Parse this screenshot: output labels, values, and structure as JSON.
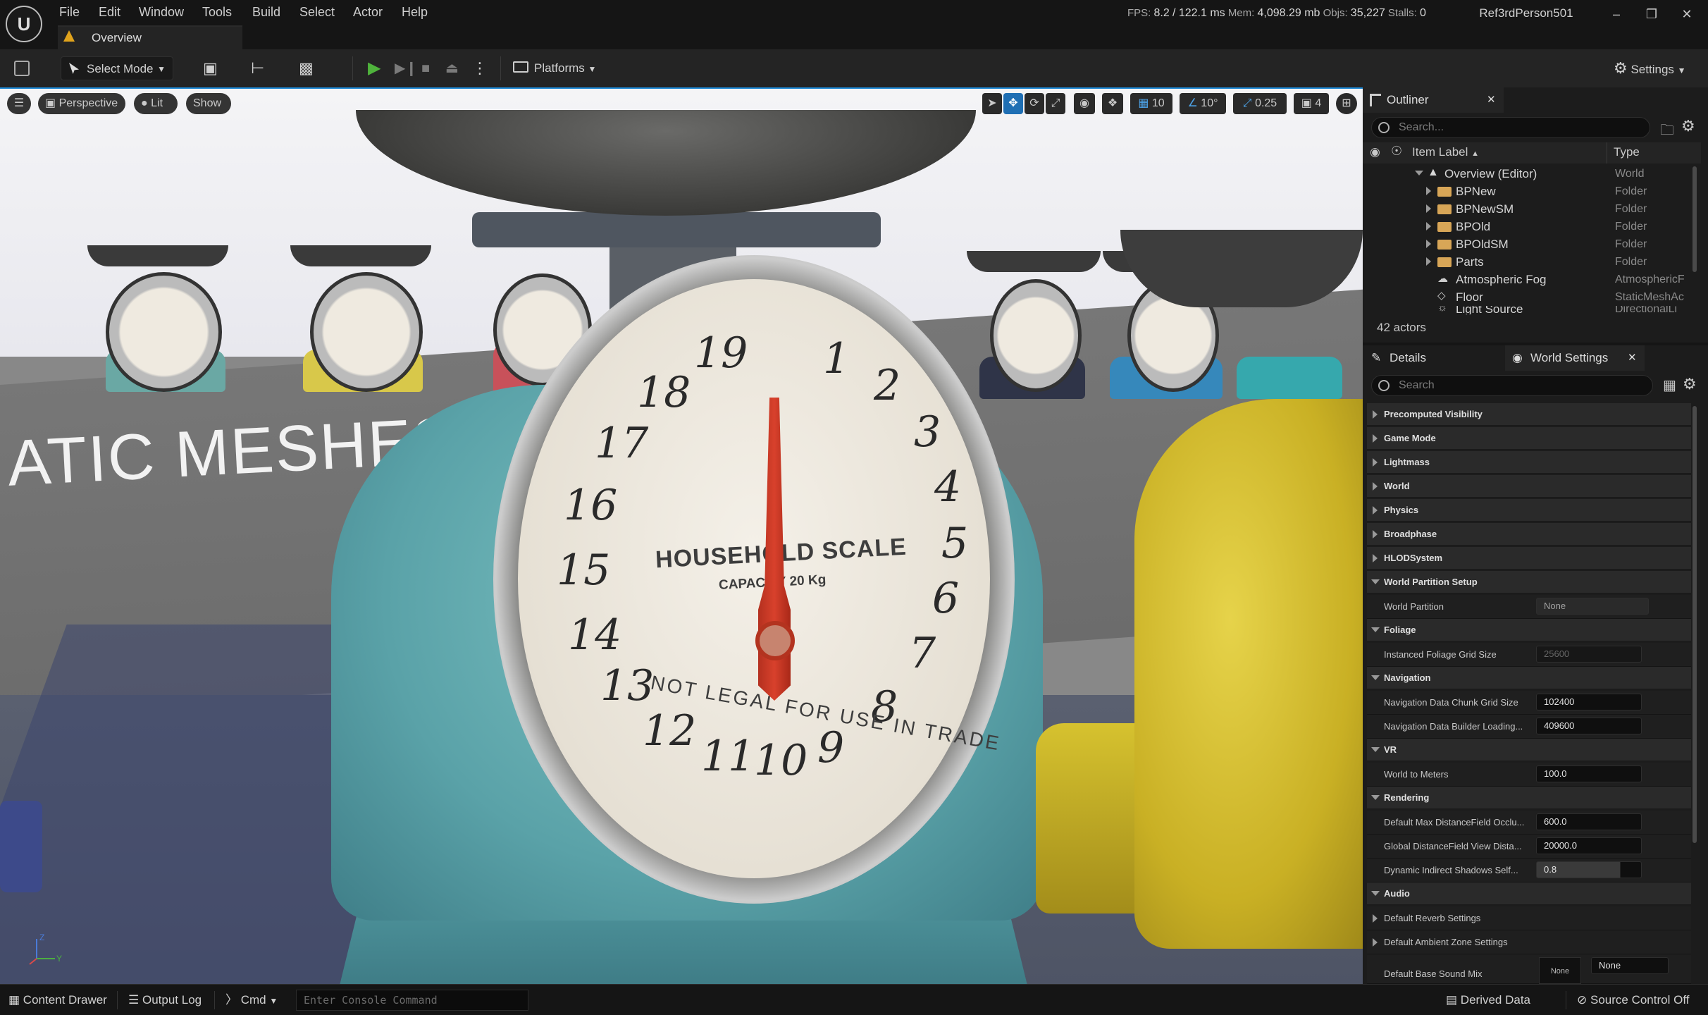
{
  "app": {
    "logo": "U",
    "menu": [
      "File",
      "Edit",
      "Window",
      "Tools",
      "Build",
      "Select",
      "Actor",
      "Help"
    ],
    "document_tab": "Overview",
    "stats": {
      "fps_label": "FPS:",
      "fps": "8.2",
      "ms": "/ 122.1 ms",
      "mem_label": "Mem:",
      "mem": "4,098.29 mb",
      "objs_label": "Objs:",
      "objs": "35,227",
      "stalls_label": "Stalls:",
      "stalls": "0"
    },
    "project_name": "Ref3rdPerson501",
    "window_controls": [
      "–",
      "❐",
      "✕"
    ]
  },
  "toolbar": {
    "select_mode": "Select Mode",
    "platforms": "Platforms",
    "settings": "Settings"
  },
  "viewport": {
    "view_mode": "Perspective",
    "lighting": "Lit",
    "show": "Show",
    "grid_snap": "10",
    "rotation_snap": "10°",
    "scale_snap": "0.25",
    "camera_speed": "4",
    "wall_text": "ATIC MESHES",
    "dial": {
      "brand": "HOUSEHOLD SCALE",
      "capacity": "CAPACITY 20 Kg",
      "legal": "NOT LEGAL FOR USE IN TRADE",
      "numbers": [
        "19",
        "1",
        "2",
        "3",
        "4",
        "5",
        "6",
        "7",
        "8",
        "9",
        "10",
        "11",
        "12",
        "13",
        "14",
        "15",
        "16",
        "17",
        "18"
      ]
    }
  },
  "outliner": {
    "tab": "Outliner",
    "search_placeholder": "Search...",
    "col_label": "Item Label",
    "col_type": "Type",
    "rows": [
      {
        "label": "Overview (Editor)",
        "type": "World"
      },
      {
        "label": "BPNew",
        "type": "Folder"
      },
      {
        "label": "BPNewSM",
        "type": "Folder"
      },
      {
        "label": "BPOld",
        "type": "Folder"
      },
      {
        "label": "BPOldSM",
        "type": "Folder"
      },
      {
        "label": "Parts",
        "type": "Folder"
      },
      {
        "label": "Atmospheric Fog",
        "type": "AtmosphericF"
      },
      {
        "label": "Floor",
        "type": "StaticMeshAc"
      },
      {
        "label": "Light Source",
        "type": "DirectionalLi"
      }
    ],
    "actor_count": "42 actors"
  },
  "details": {
    "tab_details": "Details",
    "tab_world_settings": "World Settings",
    "search_placeholder": "Search",
    "sections": {
      "precomputed_visibility": "Precomputed Visibility",
      "game_mode": "Game Mode",
      "lightmass": "Lightmass",
      "world": "World",
      "physics": "Physics",
      "broadphase": "Broadphase",
      "hlod": "HLODSystem",
      "world_partition_setup": "World Partition Setup",
      "foliage": "Foliage",
      "navigation": "Navigation",
      "vr": "VR",
      "rendering": "Rendering",
      "audio": "Audio"
    },
    "props": {
      "world_partition": {
        "label": "World Partition",
        "value": "None"
      },
      "foliage_grid": {
        "label": "Instanced Foliage Grid Size",
        "value": "25600"
      },
      "nav_chunk": {
        "label": "Navigation Data Chunk Grid Size",
        "value": "102400"
      },
      "nav_builder": {
        "label": "Navigation Data Builder Loading...",
        "value": "409600"
      },
      "world_to_meters": {
        "label": "World to Meters",
        "value": "100.0"
      },
      "df_occlusion": {
        "label": "Default Max DistanceField Occlu...",
        "value": "600.0"
      },
      "df_view_dist": {
        "label": "Global DistanceField View Dista...",
        "value": "20000.0"
      },
      "dyn_shadows": {
        "label": "Dynamic Indirect Shadows Self...",
        "value": "0.8"
      },
      "reverb": {
        "label": "Default Reverb Settings"
      },
      "ambient_zone": {
        "label": "Default Ambient Zone Settings"
      },
      "sound_mix": {
        "label": "Default Base Sound Mix",
        "value": "None",
        "thumb": "None"
      }
    }
  },
  "statusbar": {
    "content_drawer": "Content Drawer",
    "output_log": "Output Log",
    "cmd": "Cmd",
    "console_placeholder": "Enter Console Command",
    "derived_data": "Derived Data",
    "source_control": "Source Control Off"
  },
  "colors": {
    "accent_blue": "#1f6fb4",
    "play_green": "#4fb33c",
    "folder": "#d8a657",
    "tab_warning": "#e0a31c"
  }
}
